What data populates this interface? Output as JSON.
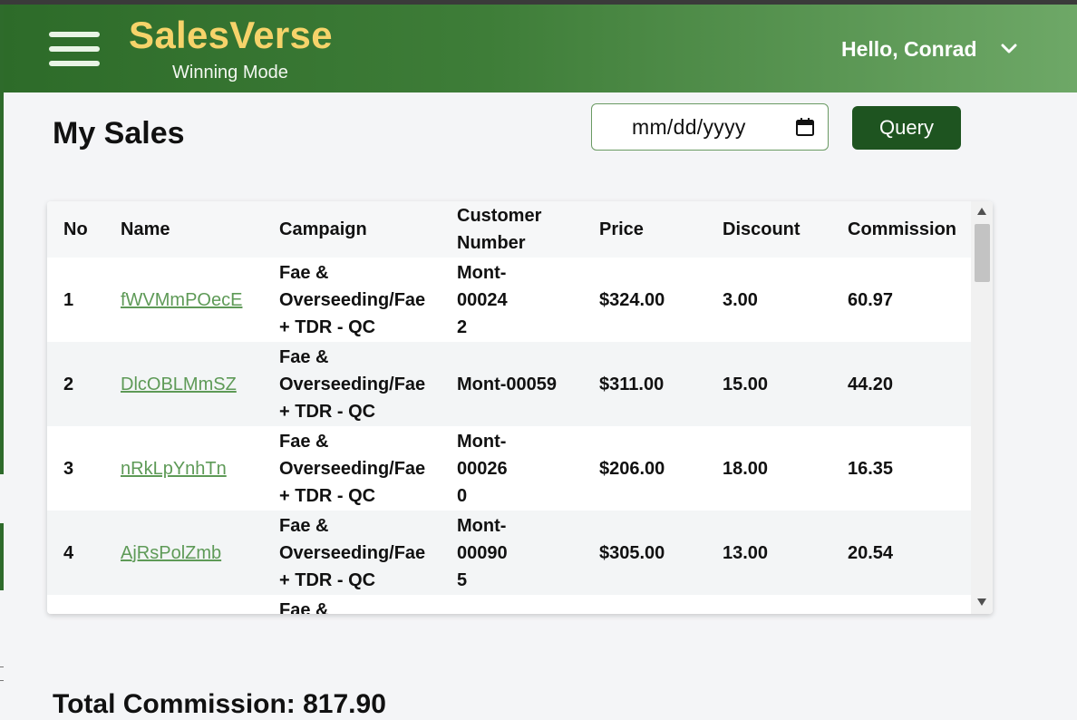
{
  "header": {
    "brand_title": "SalesVerse",
    "brand_subtitle": "Winning Mode",
    "greeting": "Hello, Conrad",
    "colors": {
      "header_dark": "#2d6b29",
      "header_light": "#6ea867",
      "brand_yellow": "#f6d36a"
    }
  },
  "main": {
    "page_title": "My Sales",
    "date_placeholder": "mm/dd/yyyy",
    "query_label": "Query",
    "query_color": "#1e5420",
    "total_label": "Total Commission: 817.90"
  },
  "table": {
    "columns": [
      "No",
      "Name",
      "Campaign",
      "Customer Number",
      "Price",
      "Discount",
      "Commission"
    ],
    "rows": [
      {
        "no": "1",
        "name": "fWVMmPOecE",
        "campaign": "Fae & Overseeding/Fae + TDR - QC",
        "customer": "Mont-000242",
        "price": "$324.00",
        "discount": "3.00",
        "commission": "60.97"
      },
      {
        "no": "2",
        "name": "DlcOBLMmSZ",
        "campaign": "Fae & Overseeding/Fae + TDR - QC",
        "customer": "Mont-00059",
        "price": "$311.00",
        "discount": "15.00",
        "commission": "44.20"
      },
      {
        "no": "3",
        "name": "nRkLpYnhTn",
        "campaign": "Fae & Overseeding/Fae + TDR - QC",
        "customer": "Mont-000260",
        "price": "$206.00",
        "discount": "18.00",
        "commission": "16.35"
      },
      {
        "no": "4",
        "name": "AjRsPolZmb",
        "campaign": "Fae & Overseeding/Fae + TDR - QC",
        "customer": "Mont-000905",
        "price": "$305.00",
        "discount": "13.00",
        "commission": "20.54"
      },
      {
        "no": "",
        "name": "",
        "campaign": "Fae &",
        "customer": "",
        "price": "",
        "discount": "",
        "commission": ""
      }
    ],
    "link_color": "#5e9a57"
  }
}
